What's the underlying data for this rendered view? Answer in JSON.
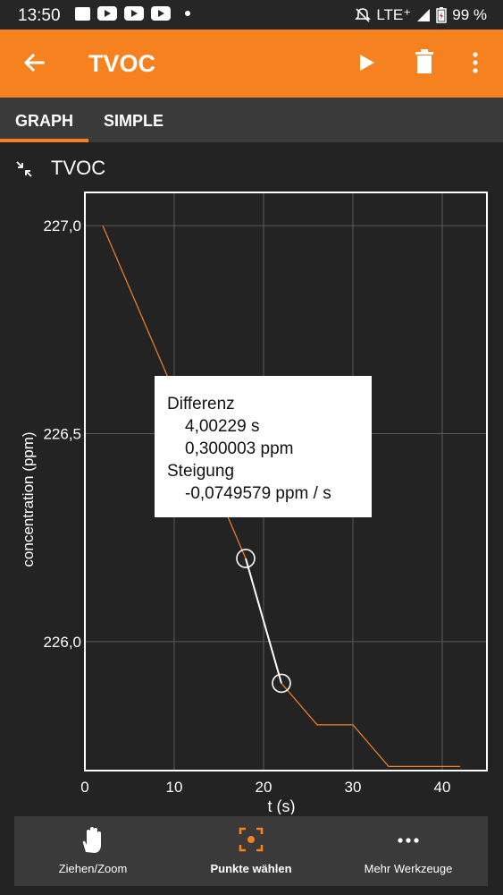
{
  "status": {
    "time": "13:50",
    "network": "LTE⁺",
    "battery": "99 %"
  },
  "app_bar": {
    "title": "TVOC",
    "icons": [
      "back-arrow-icon",
      "play-icon",
      "trash-icon",
      "more-vert-icon"
    ]
  },
  "tabs": [
    {
      "label": "GRAPH",
      "selected": true
    },
    {
      "label": "SIMPLE",
      "selected": false
    }
  ],
  "graph": {
    "title": "TVOC",
    "collapse_icon": "collapse-icon"
  },
  "colors": {
    "accent": "#f5821f",
    "background": "#232323",
    "series": "#f5821f"
  },
  "chart_data": {
    "type": "line",
    "xlabel": "t (s)",
    "ylabel": "concentration (ppm)",
    "xlim": [
      0,
      45
    ],
    "ylim": [
      225.69,
      227.08
    ],
    "x_ticks": [
      "0",
      "10",
      "20",
      "30",
      "40"
    ],
    "y_ticks": [
      "226,0",
      "226,5",
      "227,0"
    ],
    "grid": true,
    "series": [
      {
        "x": [
          2,
          18,
          22,
          26,
          30,
          34,
          42
        ],
        "y": [
          227.0,
          226.2,
          225.9,
          225.8,
          225.8,
          225.7,
          225.7
        ]
      }
    ],
    "selected_points": [
      {
        "x": 18,
        "y": 226.2
      },
      {
        "x": 22,
        "y": 225.9
      }
    ]
  },
  "tooltip": {
    "diff_label": "Differenz",
    "dt": "4,00229 s",
    "dy": "0,300003 ppm",
    "slope_label": "Steigung",
    "slope": "-0,0749579 ppm /  s"
  },
  "bottom_nav": [
    {
      "label": "Ziehen/Zoom",
      "icon": "hand-icon",
      "active": false
    },
    {
      "label": "Punkte wählen",
      "icon": "select-points-icon",
      "active": true
    },
    {
      "label": "Mehr Werkzeuge",
      "icon": "more-horiz-icon",
      "active": false
    }
  ]
}
